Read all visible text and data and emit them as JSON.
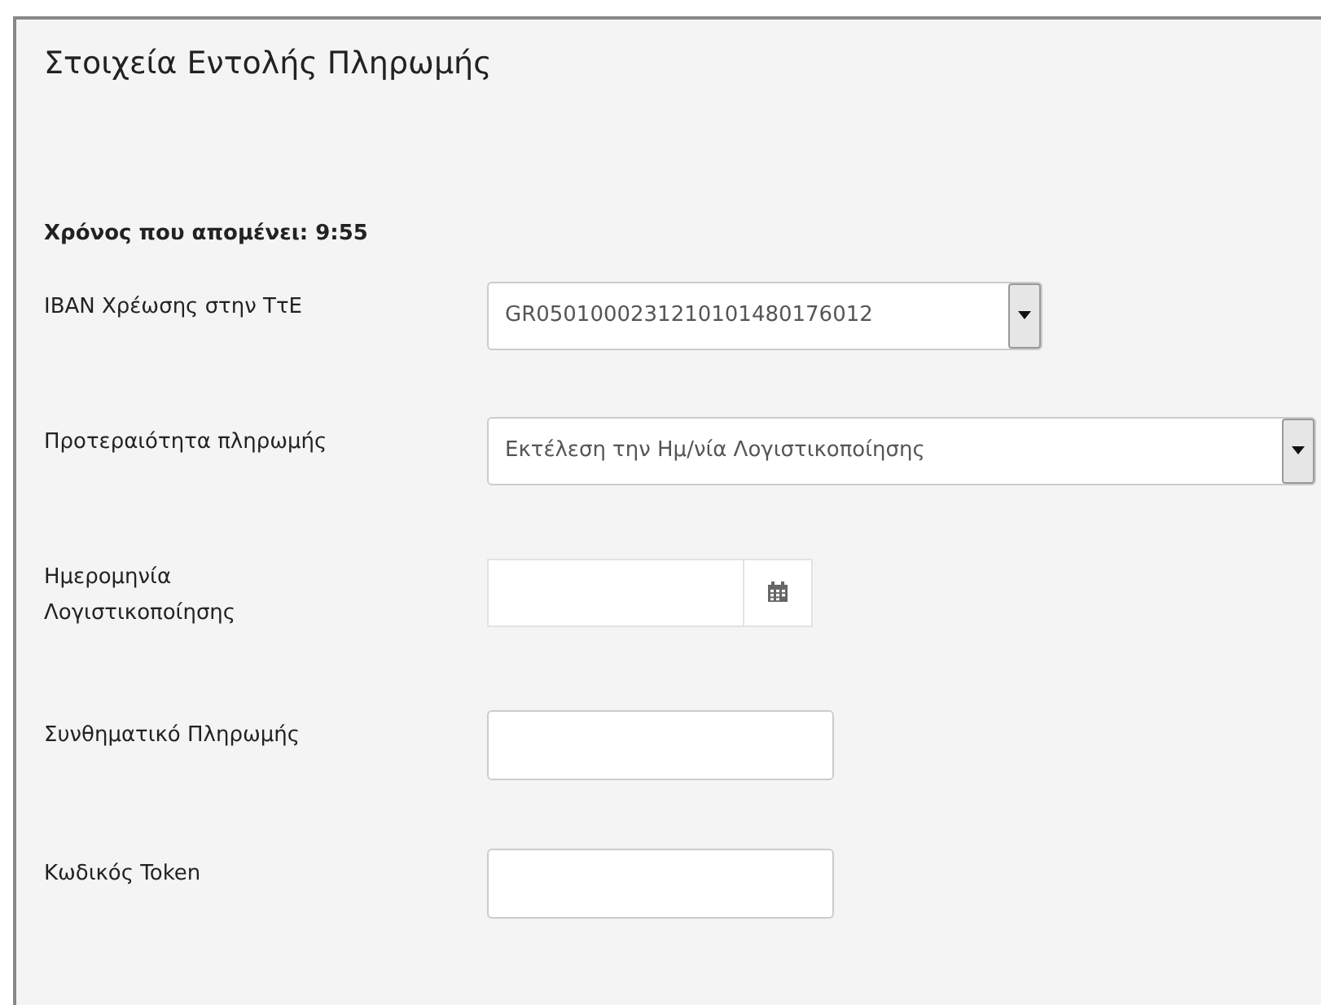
{
  "title": "Στοιχεία Εντολής Πληρωμής",
  "timer": "Χρόνος που απομένει: 9:55",
  "fields": [
    {
      "kind": "select",
      "label": "IBAN Χρέωσης στην ΤτΕ",
      "value": "GR0501000231210101480176012"
    },
    {
      "kind": "wideselect",
      "label": "Προτεραιότητα πληρωμής",
      "value": "Εκτέλεση την Ημ/νία Λογιστικοποίησης"
    },
    {
      "kind": "date",
      "label": "Ημερομηνία Λογιστικοποίησης"
    },
    {
      "kind": "text",
      "label": "Συνθηματικό Πληρωμής"
    },
    {
      "kind": "text",
      "label": "Κωδικός Token"
    }
  ]
}
